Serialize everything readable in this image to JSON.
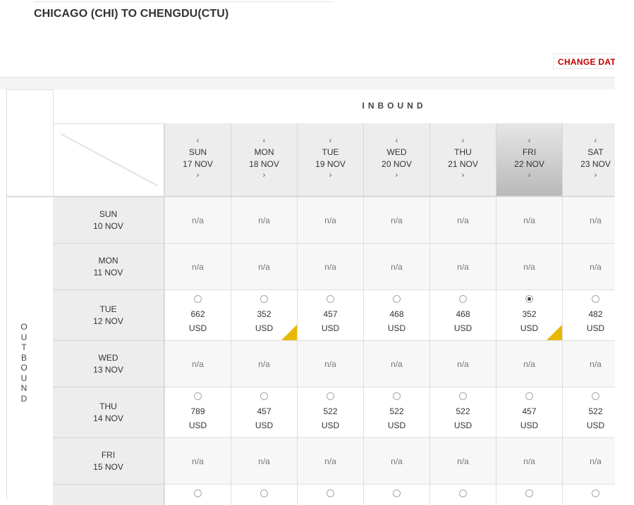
{
  "header": {
    "title": "CHICAGO (CHI) TO CHENGDU(CTU)",
    "change_date": "CHANGE DATE"
  },
  "matrix": {
    "inbound_label": "INBOUND",
    "outbound_letters": [
      "O",
      "U",
      "T",
      "B",
      "O",
      "U",
      "N",
      "D"
    ],
    "prev_arrow": "‹",
    "next_arrow": "›",
    "inbound_days": [
      {
        "day": "SUN",
        "date": "17 NOV",
        "selected": false
      },
      {
        "day": "MON",
        "date": "18 NOV",
        "selected": false
      },
      {
        "day": "TUE",
        "date": "19 NOV",
        "selected": false
      },
      {
        "day": "WED",
        "date": "20 NOV",
        "selected": false
      },
      {
        "day": "THU",
        "date": "21 NOV",
        "selected": false
      },
      {
        "day": "FRI",
        "date": "22 NOV",
        "selected": true
      },
      {
        "day": "SAT",
        "date": "23 NOV",
        "selected": false
      }
    ],
    "outbound_days": [
      {
        "day": "SUN",
        "date": "10 NOV"
      },
      {
        "day": "MON",
        "date": "11 NOV"
      },
      {
        "day": "TUE",
        "date": "12 NOV"
      },
      {
        "day": "WED",
        "date": "13 NOV"
      },
      {
        "day": "THU",
        "date": "14 NOV"
      },
      {
        "day": "FRI",
        "date": "15 NOV"
      },
      {
        "day": "",
        "date": ""
      }
    ],
    "rows": [
      {
        "cells": [
          {
            "na": "n/a"
          },
          {
            "na": "n/a"
          },
          {
            "na": "n/a"
          },
          {
            "na": "n/a"
          },
          {
            "na": "n/a"
          },
          {
            "na": "n/a"
          },
          {
            "na": "n/a"
          }
        ]
      },
      {
        "cells": [
          {
            "na": "n/a"
          },
          {
            "na": "n/a"
          },
          {
            "na": "n/a"
          },
          {
            "na": "n/a"
          },
          {
            "na": "n/a"
          },
          {
            "na": "n/a"
          },
          {
            "na": "n/a"
          }
        ]
      },
      {
        "cells": [
          {
            "price": "662",
            "currency": "USD",
            "checked": false,
            "lowest": false
          },
          {
            "price": "352",
            "currency": "USD",
            "checked": false,
            "lowest": true
          },
          {
            "price": "457",
            "currency": "USD",
            "checked": false,
            "lowest": false
          },
          {
            "price": "468",
            "currency": "USD",
            "checked": false,
            "lowest": false
          },
          {
            "price": "468",
            "currency": "USD",
            "checked": false,
            "lowest": false
          },
          {
            "price": "352",
            "currency": "USD",
            "checked": true,
            "lowest": true
          },
          {
            "price": "482",
            "currency": "USD",
            "checked": false,
            "lowest": false
          }
        ]
      },
      {
        "cells": [
          {
            "na": "n/a"
          },
          {
            "na": "n/a"
          },
          {
            "na": "n/a"
          },
          {
            "na": "n/a"
          },
          {
            "na": "n/a"
          },
          {
            "na": "n/a"
          },
          {
            "na": "n/a"
          }
        ]
      },
      {
        "cells": [
          {
            "price": "789",
            "currency": "USD",
            "checked": false,
            "lowest": false
          },
          {
            "price": "457",
            "currency": "USD",
            "checked": false,
            "lowest": false
          },
          {
            "price": "522",
            "currency": "USD",
            "checked": false,
            "lowest": false
          },
          {
            "price": "522",
            "currency": "USD",
            "checked": false,
            "lowest": false
          },
          {
            "price": "522",
            "currency": "USD",
            "checked": false,
            "lowest": false
          },
          {
            "price": "457",
            "currency": "USD",
            "checked": false,
            "lowest": false
          },
          {
            "price": "522",
            "currency": "USD",
            "checked": false,
            "lowest": false
          }
        ]
      },
      {
        "cells": [
          {
            "na": "n/a"
          },
          {
            "na": "n/a"
          },
          {
            "na": "n/a"
          },
          {
            "na": "n/a"
          },
          {
            "na": "n/a"
          },
          {
            "na": "n/a"
          },
          {
            "na": "n/a"
          }
        ]
      },
      {
        "cells": [
          {
            "price": "",
            "currency": "",
            "checked": false,
            "lowest": false
          },
          {
            "price": "",
            "currency": "",
            "checked": false,
            "lowest": false
          },
          {
            "price": "",
            "currency": "",
            "checked": false,
            "lowest": false
          },
          {
            "price": "",
            "currency": "",
            "checked": false,
            "lowest": false
          },
          {
            "price": "",
            "currency": "",
            "checked": false,
            "lowest": false
          },
          {
            "price": "",
            "currency": "",
            "checked": false,
            "lowest": false
          },
          {
            "price": "",
            "currency": "",
            "checked": false,
            "lowest": false
          }
        ]
      }
    ]
  },
  "colors": {
    "accent_red": "#c00000",
    "lowest_fare_flag": "#e8b800",
    "header_gray": "#ededed"
  },
  "icons": {
    "lowest_fare_flag": "corner-triangle-icon",
    "fare_radio": "radio-icon"
  }
}
